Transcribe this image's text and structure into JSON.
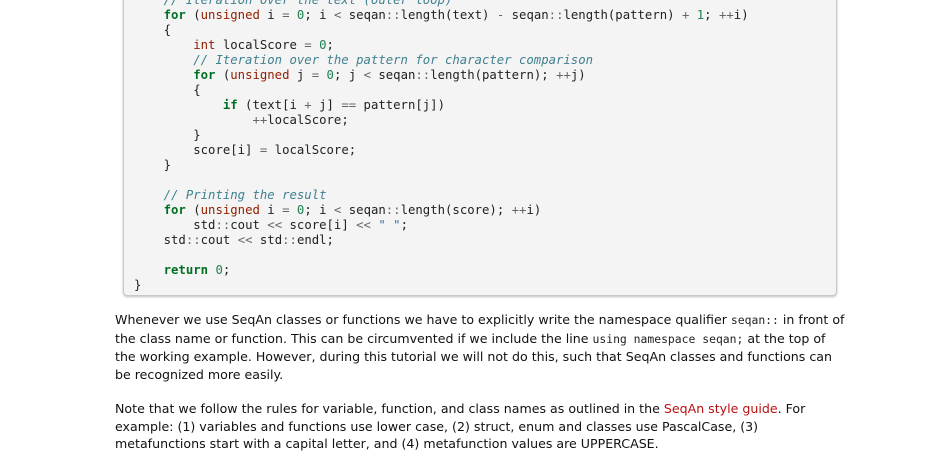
{
  "code_lines": [
    {
      "indent": "    ",
      "tokens": [
        {
          "c": "cm",
          "t": "// Iteration over the text (outer loop)"
        }
      ]
    },
    {
      "indent": "    ",
      "tokens": [
        {
          "c": "kw",
          "t": "for"
        },
        {
          "c": "",
          "t": " ("
        },
        {
          "c": "ty",
          "t": "unsigned"
        },
        {
          "c": "",
          "t": " i "
        },
        {
          "c": "op",
          "t": "="
        },
        {
          "c": "",
          "t": " "
        },
        {
          "c": "num",
          "t": "0"
        },
        {
          "c": "",
          "t": "; i "
        },
        {
          "c": "op",
          "t": "<"
        },
        {
          "c": "",
          "t": " seqan"
        },
        {
          "c": "op",
          "t": "::"
        },
        {
          "c": "",
          "t": "length(text) "
        },
        {
          "c": "op",
          "t": "-"
        },
        {
          "c": "",
          "t": " seqan"
        },
        {
          "c": "op",
          "t": "::"
        },
        {
          "c": "",
          "t": "length(pattern) "
        },
        {
          "c": "op",
          "t": "+"
        },
        {
          "c": "",
          "t": " "
        },
        {
          "c": "num",
          "t": "1"
        },
        {
          "c": "",
          "t": "; "
        },
        {
          "c": "op",
          "t": "++"
        },
        {
          "c": "",
          "t": "i)"
        }
      ]
    },
    {
      "indent": "    ",
      "tokens": [
        {
          "c": "",
          "t": "{"
        }
      ]
    },
    {
      "indent": "        ",
      "tokens": [
        {
          "c": "ty",
          "t": "int"
        },
        {
          "c": "",
          "t": " localScore "
        },
        {
          "c": "op",
          "t": "="
        },
        {
          "c": "",
          "t": " "
        },
        {
          "c": "num",
          "t": "0"
        },
        {
          "c": "",
          "t": ";"
        }
      ]
    },
    {
      "indent": "        ",
      "tokens": [
        {
          "c": "cm",
          "t": "// Iteration over the pattern for character comparison"
        }
      ]
    },
    {
      "indent": "        ",
      "tokens": [
        {
          "c": "kw",
          "t": "for"
        },
        {
          "c": "",
          "t": " ("
        },
        {
          "c": "ty",
          "t": "unsigned"
        },
        {
          "c": "",
          "t": " j "
        },
        {
          "c": "op",
          "t": "="
        },
        {
          "c": "",
          "t": " "
        },
        {
          "c": "num",
          "t": "0"
        },
        {
          "c": "",
          "t": "; j "
        },
        {
          "c": "op",
          "t": "<"
        },
        {
          "c": "",
          "t": " seqan"
        },
        {
          "c": "op",
          "t": "::"
        },
        {
          "c": "",
          "t": "length(pattern); "
        },
        {
          "c": "op",
          "t": "++"
        },
        {
          "c": "",
          "t": "j)"
        }
      ]
    },
    {
      "indent": "        ",
      "tokens": [
        {
          "c": "",
          "t": "{"
        }
      ]
    },
    {
      "indent": "            ",
      "tokens": [
        {
          "c": "kw",
          "t": "if"
        },
        {
          "c": "",
          "t": " (text[i "
        },
        {
          "c": "op",
          "t": "+"
        },
        {
          "c": "",
          "t": " j] "
        },
        {
          "c": "op",
          "t": "=="
        },
        {
          "c": "",
          "t": " pattern[j])"
        }
      ]
    },
    {
      "indent": "                ",
      "tokens": [
        {
          "c": "op",
          "t": "++"
        },
        {
          "c": "",
          "t": "localScore;"
        }
      ]
    },
    {
      "indent": "        ",
      "tokens": [
        {
          "c": "",
          "t": "}"
        }
      ]
    },
    {
      "indent": "        ",
      "tokens": [
        {
          "c": "",
          "t": "score[i] "
        },
        {
          "c": "op",
          "t": "="
        },
        {
          "c": "",
          "t": " localScore;"
        }
      ]
    },
    {
      "indent": "    ",
      "tokens": [
        {
          "c": "",
          "t": "}"
        }
      ]
    },
    {
      "indent": "",
      "tokens": []
    },
    {
      "indent": "    ",
      "tokens": [
        {
          "c": "cm",
          "t": "// Printing the result"
        }
      ]
    },
    {
      "indent": "    ",
      "tokens": [
        {
          "c": "kw",
          "t": "for"
        },
        {
          "c": "",
          "t": " ("
        },
        {
          "c": "ty",
          "t": "unsigned"
        },
        {
          "c": "",
          "t": " i "
        },
        {
          "c": "op",
          "t": "="
        },
        {
          "c": "",
          "t": " "
        },
        {
          "c": "num",
          "t": "0"
        },
        {
          "c": "",
          "t": "; i "
        },
        {
          "c": "op",
          "t": "<"
        },
        {
          "c": "",
          "t": " seqan"
        },
        {
          "c": "op",
          "t": "::"
        },
        {
          "c": "",
          "t": "length(score); "
        },
        {
          "c": "op",
          "t": "++"
        },
        {
          "c": "",
          "t": "i)"
        }
      ]
    },
    {
      "indent": "        ",
      "tokens": [
        {
          "c": "",
          "t": "std"
        },
        {
          "c": "op",
          "t": "::"
        },
        {
          "c": "",
          "t": "cout "
        },
        {
          "c": "op",
          "t": "<<"
        },
        {
          "c": "",
          "t": " score[i] "
        },
        {
          "c": "op",
          "t": "<<"
        },
        {
          "c": "",
          "t": " "
        },
        {
          "c": "str",
          "t": "\" \""
        },
        {
          "c": "",
          "t": ";"
        }
      ]
    },
    {
      "indent": "    ",
      "tokens": [
        {
          "c": "",
          "t": "std"
        },
        {
          "c": "op",
          "t": "::"
        },
        {
          "c": "",
          "t": "cout "
        },
        {
          "c": "op",
          "t": "<<"
        },
        {
          "c": "",
          "t": " std"
        },
        {
          "c": "op",
          "t": "::"
        },
        {
          "c": "",
          "t": "endl;"
        }
      ]
    },
    {
      "indent": "",
      "tokens": []
    },
    {
      "indent": "    ",
      "tokens": [
        {
          "c": "kw",
          "t": "return"
        },
        {
          "c": "",
          "t": " "
        },
        {
          "c": "num",
          "t": "0"
        },
        {
          "c": "",
          "t": ";"
        }
      ]
    },
    {
      "indent": "",
      "tokens": [
        {
          "c": "",
          "t": "}"
        }
      ]
    }
  ],
  "paragraph1": {
    "t1": "Whenever we use SeqAn classes or functions we have to explicitly write the namespace qualifier ",
    "code1": "seqan::",
    "t2": " in front of the class name or function. This can be circumvented if we include the line ",
    "code2": "using namespace seqan;",
    "t3": " at the top of the working example. However, during this tutorial we will not do this, such that SeqAn classes and functions can be recognized more easily."
  },
  "paragraph2": {
    "t1": "Note that we follow the rules for variable, function, and class names as outlined in the ",
    "link": "SeqAn style guide",
    "t2": ". For example: (1) variables and functions use lower case, (2) struct, enum and classes use PascalCase, (3) metafunctions start with a capital letter, and (4) metafunction values are UPPERCASE."
  }
}
